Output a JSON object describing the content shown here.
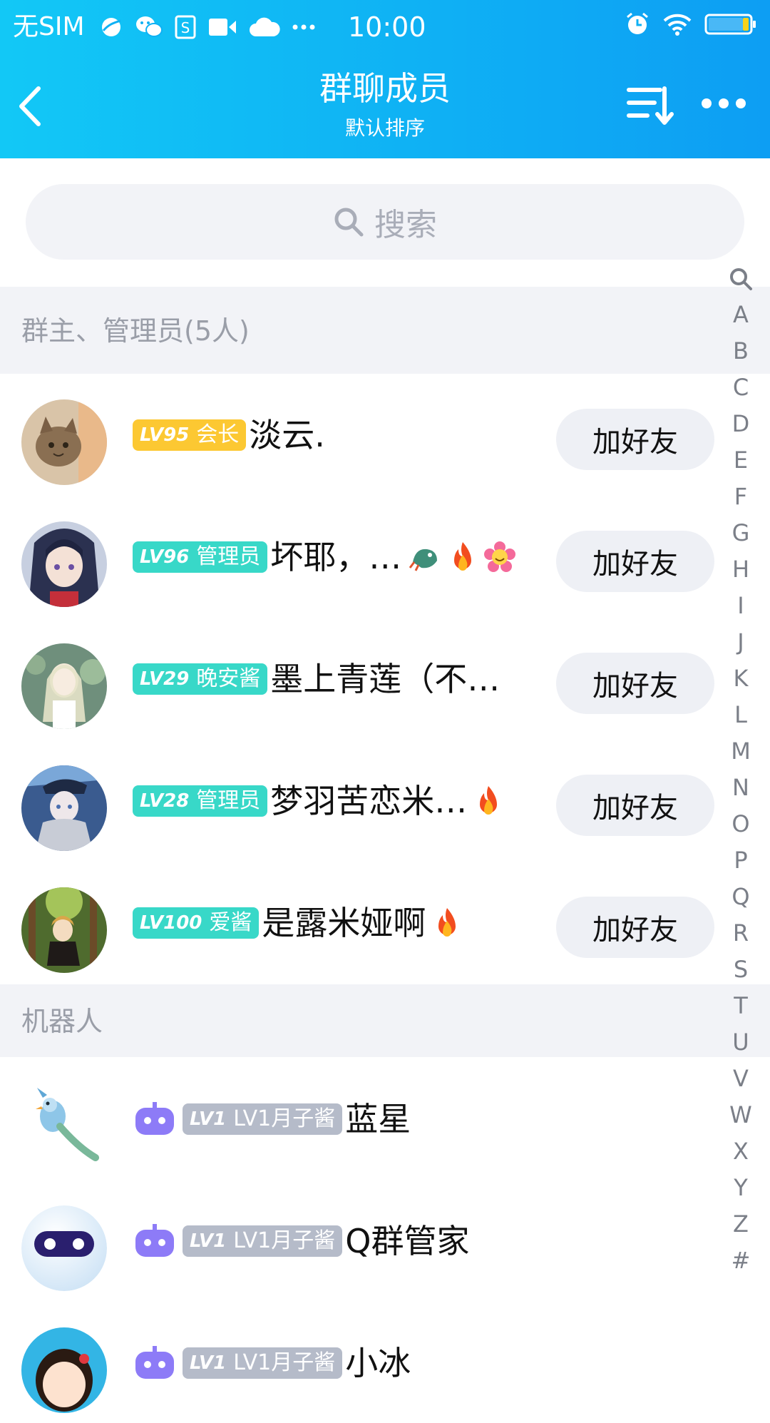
{
  "status_bar": {
    "carrier": "无SIM",
    "time": "10:00",
    "left_icons": [
      "browser-icon",
      "wechat-icon",
      "s-app-icon",
      "video-icon",
      "cloud-icon",
      "more-dots-icon"
    ],
    "right_icons": [
      "alarm-icon",
      "wifi-icon",
      "battery-icon"
    ]
  },
  "nav": {
    "title": "群聊成员",
    "subtitle": "默认排序"
  },
  "search": {
    "placeholder": "搜索"
  },
  "colors": {
    "header_gradient_start": "#12c8f6",
    "header_gradient_end": "#0d9ef3",
    "tag_owner": "#fcc832",
    "tag_admin": "#38d8c8",
    "tag_bot": "#b5bbc9",
    "bot_icon": "#8d7bf7"
  },
  "sections": [
    {
      "title": "群主、管理员(5人)",
      "members": [
        {
          "level": "LV95",
          "tag": "会长",
          "tag_color": "#fcc832",
          "name": "淡云.",
          "emojis": [],
          "action": "加好友",
          "avatar": "cat-avatar"
        },
        {
          "level": "LV96",
          "tag": "管理员",
          "tag_color": "#38d8c8",
          "name": "坏耶，…",
          "emojis": [
            "dragon-emoji",
            "fire-emoji",
            "flower-emoji"
          ],
          "action": "加好友",
          "avatar": "anime-girl-avatar"
        },
        {
          "level": "LV29",
          "tag": "晚安酱",
          "tag_color": "#38d8c8",
          "name": "墨上青莲（不…",
          "emojis": [],
          "action": "加好友",
          "avatar": "fairy-avatar"
        },
        {
          "level": "LV28",
          "tag": "管理员",
          "tag_color": "#38d8c8",
          "name": "梦羽苦恋米…",
          "emojis": [
            "fire-emoji"
          ],
          "action": "加好友",
          "avatar": "knight-avatar"
        },
        {
          "level": "LV100",
          "tag": "爱酱",
          "tag_color": "#38d8c8",
          "name": "是露米娅啊",
          "emojis": [
            "fire-emoji"
          ],
          "action": "加好友",
          "avatar": "forest-girl-avatar"
        }
      ]
    },
    {
      "title": "机器人",
      "members": [
        {
          "level": "LV1",
          "tag": "LV1月子酱",
          "tag_color": "#b5bbc9",
          "name": "蓝星",
          "avatar": "bird-avatar"
        },
        {
          "level": "LV1",
          "tag": "LV1月子酱",
          "tag_color": "#b5bbc9",
          "name": "Q群管家",
          "avatar": "robot-ball-avatar"
        },
        {
          "level": "LV1",
          "tag": "LV1月子酱",
          "tag_color": "#b5bbc9",
          "name": "小冰",
          "avatar": "girl-cartoon-avatar"
        }
      ]
    }
  ],
  "index_letters": [
    "A",
    "B",
    "C",
    "D",
    "E",
    "F",
    "G",
    "H",
    "I",
    "J",
    "K",
    "L",
    "M",
    "N",
    "O",
    "P",
    "Q",
    "R",
    "S",
    "T",
    "U",
    "V",
    "W",
    "X",
    "Y",
    "Z",
    "#"
  ]
}
